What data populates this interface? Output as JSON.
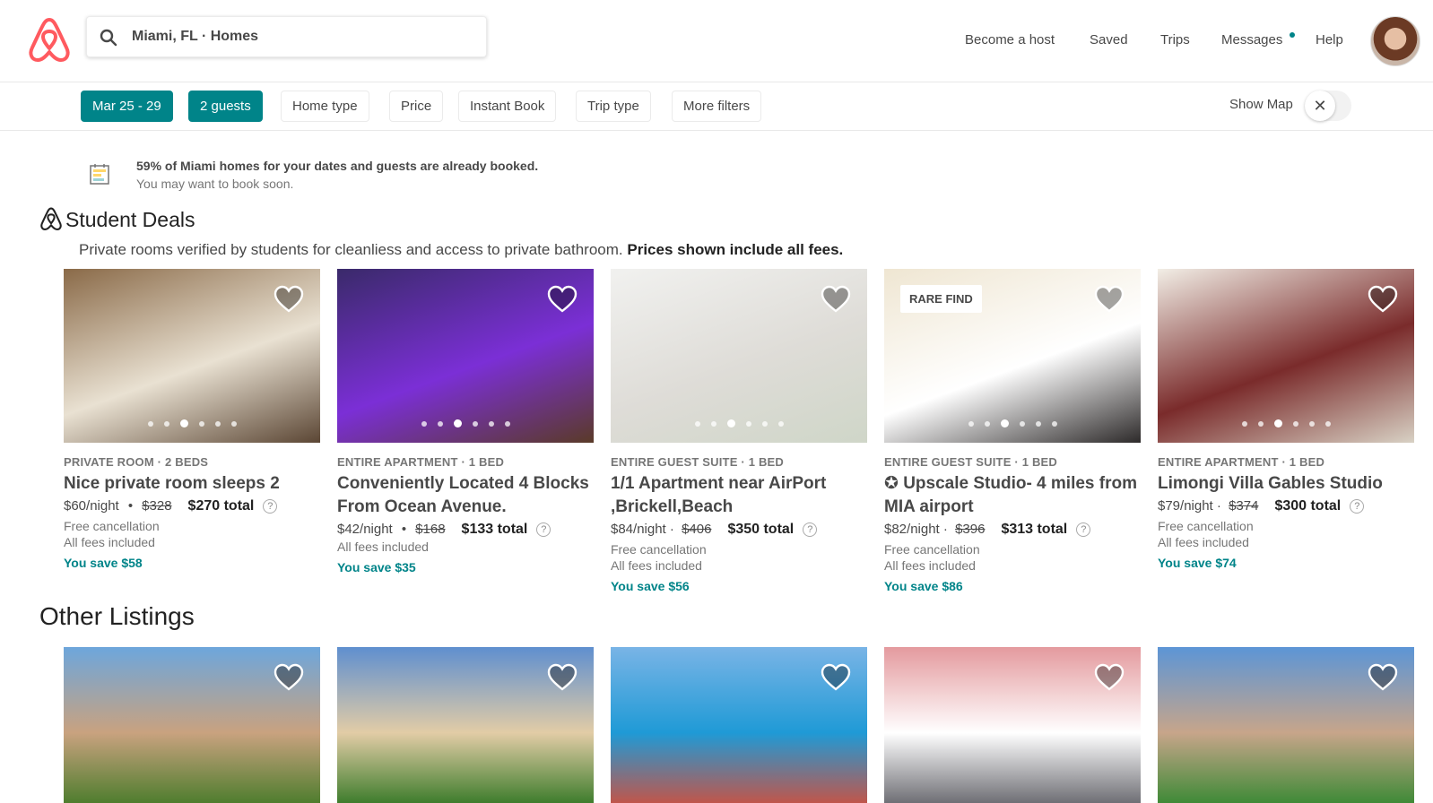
{
  "header": {
    "search_value": "Miami, FL · Homes",
    "nav": [
      "Become a host",
      "Saved",
      "Trips",
      "Messages",
      "Help"
    ]
  },
  "filters": {
    "chips": [
      "Mar 25 - 29",
      "2 guests",
      "Home type",
      "Price",
      "Instant Book",
      "Trip type",
      "More filters"
    ],
    "show_map_label": "Show Map",
    "close_glyph": "✕"
  },
  "notice": {
    "line1": "59% of Miami homes for your dates and guests are already booked.",
    "line2": "You may want to book soon."
  },
  "student_deals": {
    "title": "Student Deals",
    "subtitle": "Private rooms verified by students for cleanliess and access to private bathroom.",
    "subtitle_bold": "Prices shown include all fees.",
    "listings": [
      {
        "kind": "PRIVATE ROOM · 2 BEDS",
        "title": "Nice private room sleeps 2",
        "price_night": "$60/night",
        "sep": "•",
        "old_price": "$328",
        "total": "$270 total",
        "cancellation": "Free cancellation",
        "fees": "All fees included",
        "savings": "You save $58",
        "badge": "",
        "photo_colors": [
          "#8a6a48",
          "#e9e1d2",
          "#5b4634"
        ]
      },
      {
        "kind": "ENTIRE APARTMENT · 1 BED",
        "title": "Conveniently Located 4 Blocks From Ocean Avenue.",
        "price_night": "$42/night",
        "sep": "•",
        "old_price": "$168",
        "total": "$133 total",
        "cancellation": "",
        "fees": "All fees included",
        "savings": "You save $35",
        "badge": "",
        "photo_colors": [
          "#3a2a6a",
          "#7b2fd6",
          "#5a3a28"
        ]
      },
      {
        "kind": "ENTIRE GUEST SUITE · 1 BED",
        "title": "1/1 Apartment near AirPort ,Brickell,Beach",
        "price_night": "$84/night ·",
        "sep": "",
        "old_price": "$406",
        "total": "$350 total",
        "cancellation": "Free cancellation",
        "fees": "All fees included",
        "savings": "You save $56",
        "badge": "",
        "photo_colors": [
          "#f1f1ef",
          "#dedcd7",
          "#cfd6c8"
        ]
      },
      {
        "kind": "ENTIRE GUEST SUITE · 1 BED",
        "title": "✪ Upscale Studio- 4 miles from MIA airport",
        "price_night": "$82/night ·",
        "sep": "",
        "old_price": "$396",
        "total": "$313 total",
        "cancellation": "Free cancellation",
        "fees": "All fees included",
        "savings": "You save $86",
        "badge": "RARE FIND",
        "photo_colors": [
          "#efe6d2",
          "#ffffff",
          "#2d2a2a"
        ]
      },
      {
        "kind": "ENTIRE APARTMENT · 1 BED",
        "title": "Limongi Villa Gables Studio",
        "price_night": "$79/night ·",
        "sep": "",
        "old_price": "$374",
        "total": "$300 total",
        "cancellation": "Free cancellation",
        "fees": "All fees included",
        "savings": "You save $74",
        "badge": "",
        "photo_colors": [
          "#f2eee6",
          "#7a2b2b",
          "#d8d1c4"
        ]
      }
    ]
  },
  "other_listings": {
    "title": "Other Listings",
    "photo_colors": [
      [
        "#6da6dc",
        "#c9a27f",
        "#4f7d2e"
      ],
      [
        "#5f8fcf",
        "#e2cca6",
        "#3f7d2d"
      ],
      [
        "#79b4e6",
        "#1f9ad6",
        "#c0564b"
      ],
      [
        "#e49a9e",
        "#ffffff",
        "#6f6f75"
      ],
      [
        "#5c95d6",
        "#c7a58a",
        "#3f8a37"
      ]
    ]
  },
  "colors": {
    "brand": "#FF5A5F",
    "accent": "#008489",
    "text": "#484848"
  },
  "icons": [
    "airbnb-logo-icon",
    "search-icon",
    "calendar-note-icon",
    "heart-icon",
    "close-icon",
    "help-icon"
  ]
}
